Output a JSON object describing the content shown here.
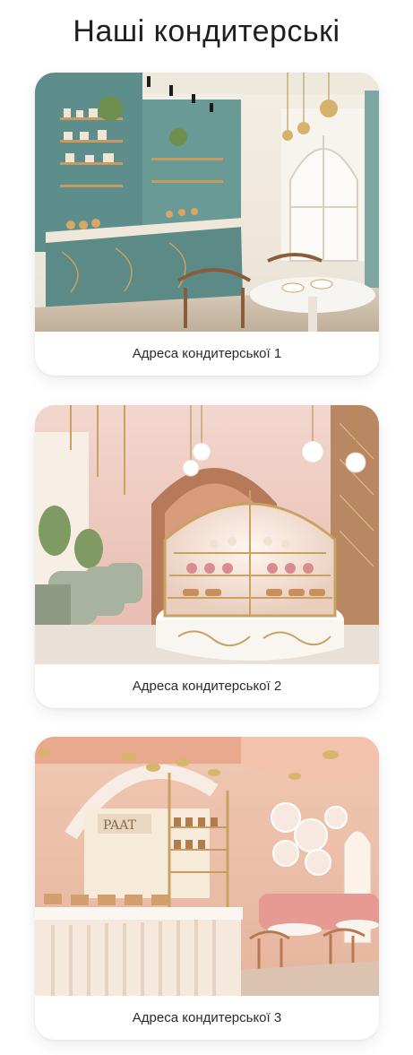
{
  "section": {
    "title": "Наші кондитерські"
  },
  "cards": [
    {
      "caption": "Адреса кондитерської 1",
      "image_alt": "teal bakery cafe interior",
      "accent": "#5f8f8c"
    },
    {
      "caption": "Адреса кондитерської 2",
      "image_alt": "pink patisserie with round glass display",
      "accent": "#e8b9b0"
    },
    {
      "caption": "Адреса кондитерської 3",
      "image_alt": "peach pastry shop with counter",
      "accent": "#e6a98f"
    }
  ]
}
